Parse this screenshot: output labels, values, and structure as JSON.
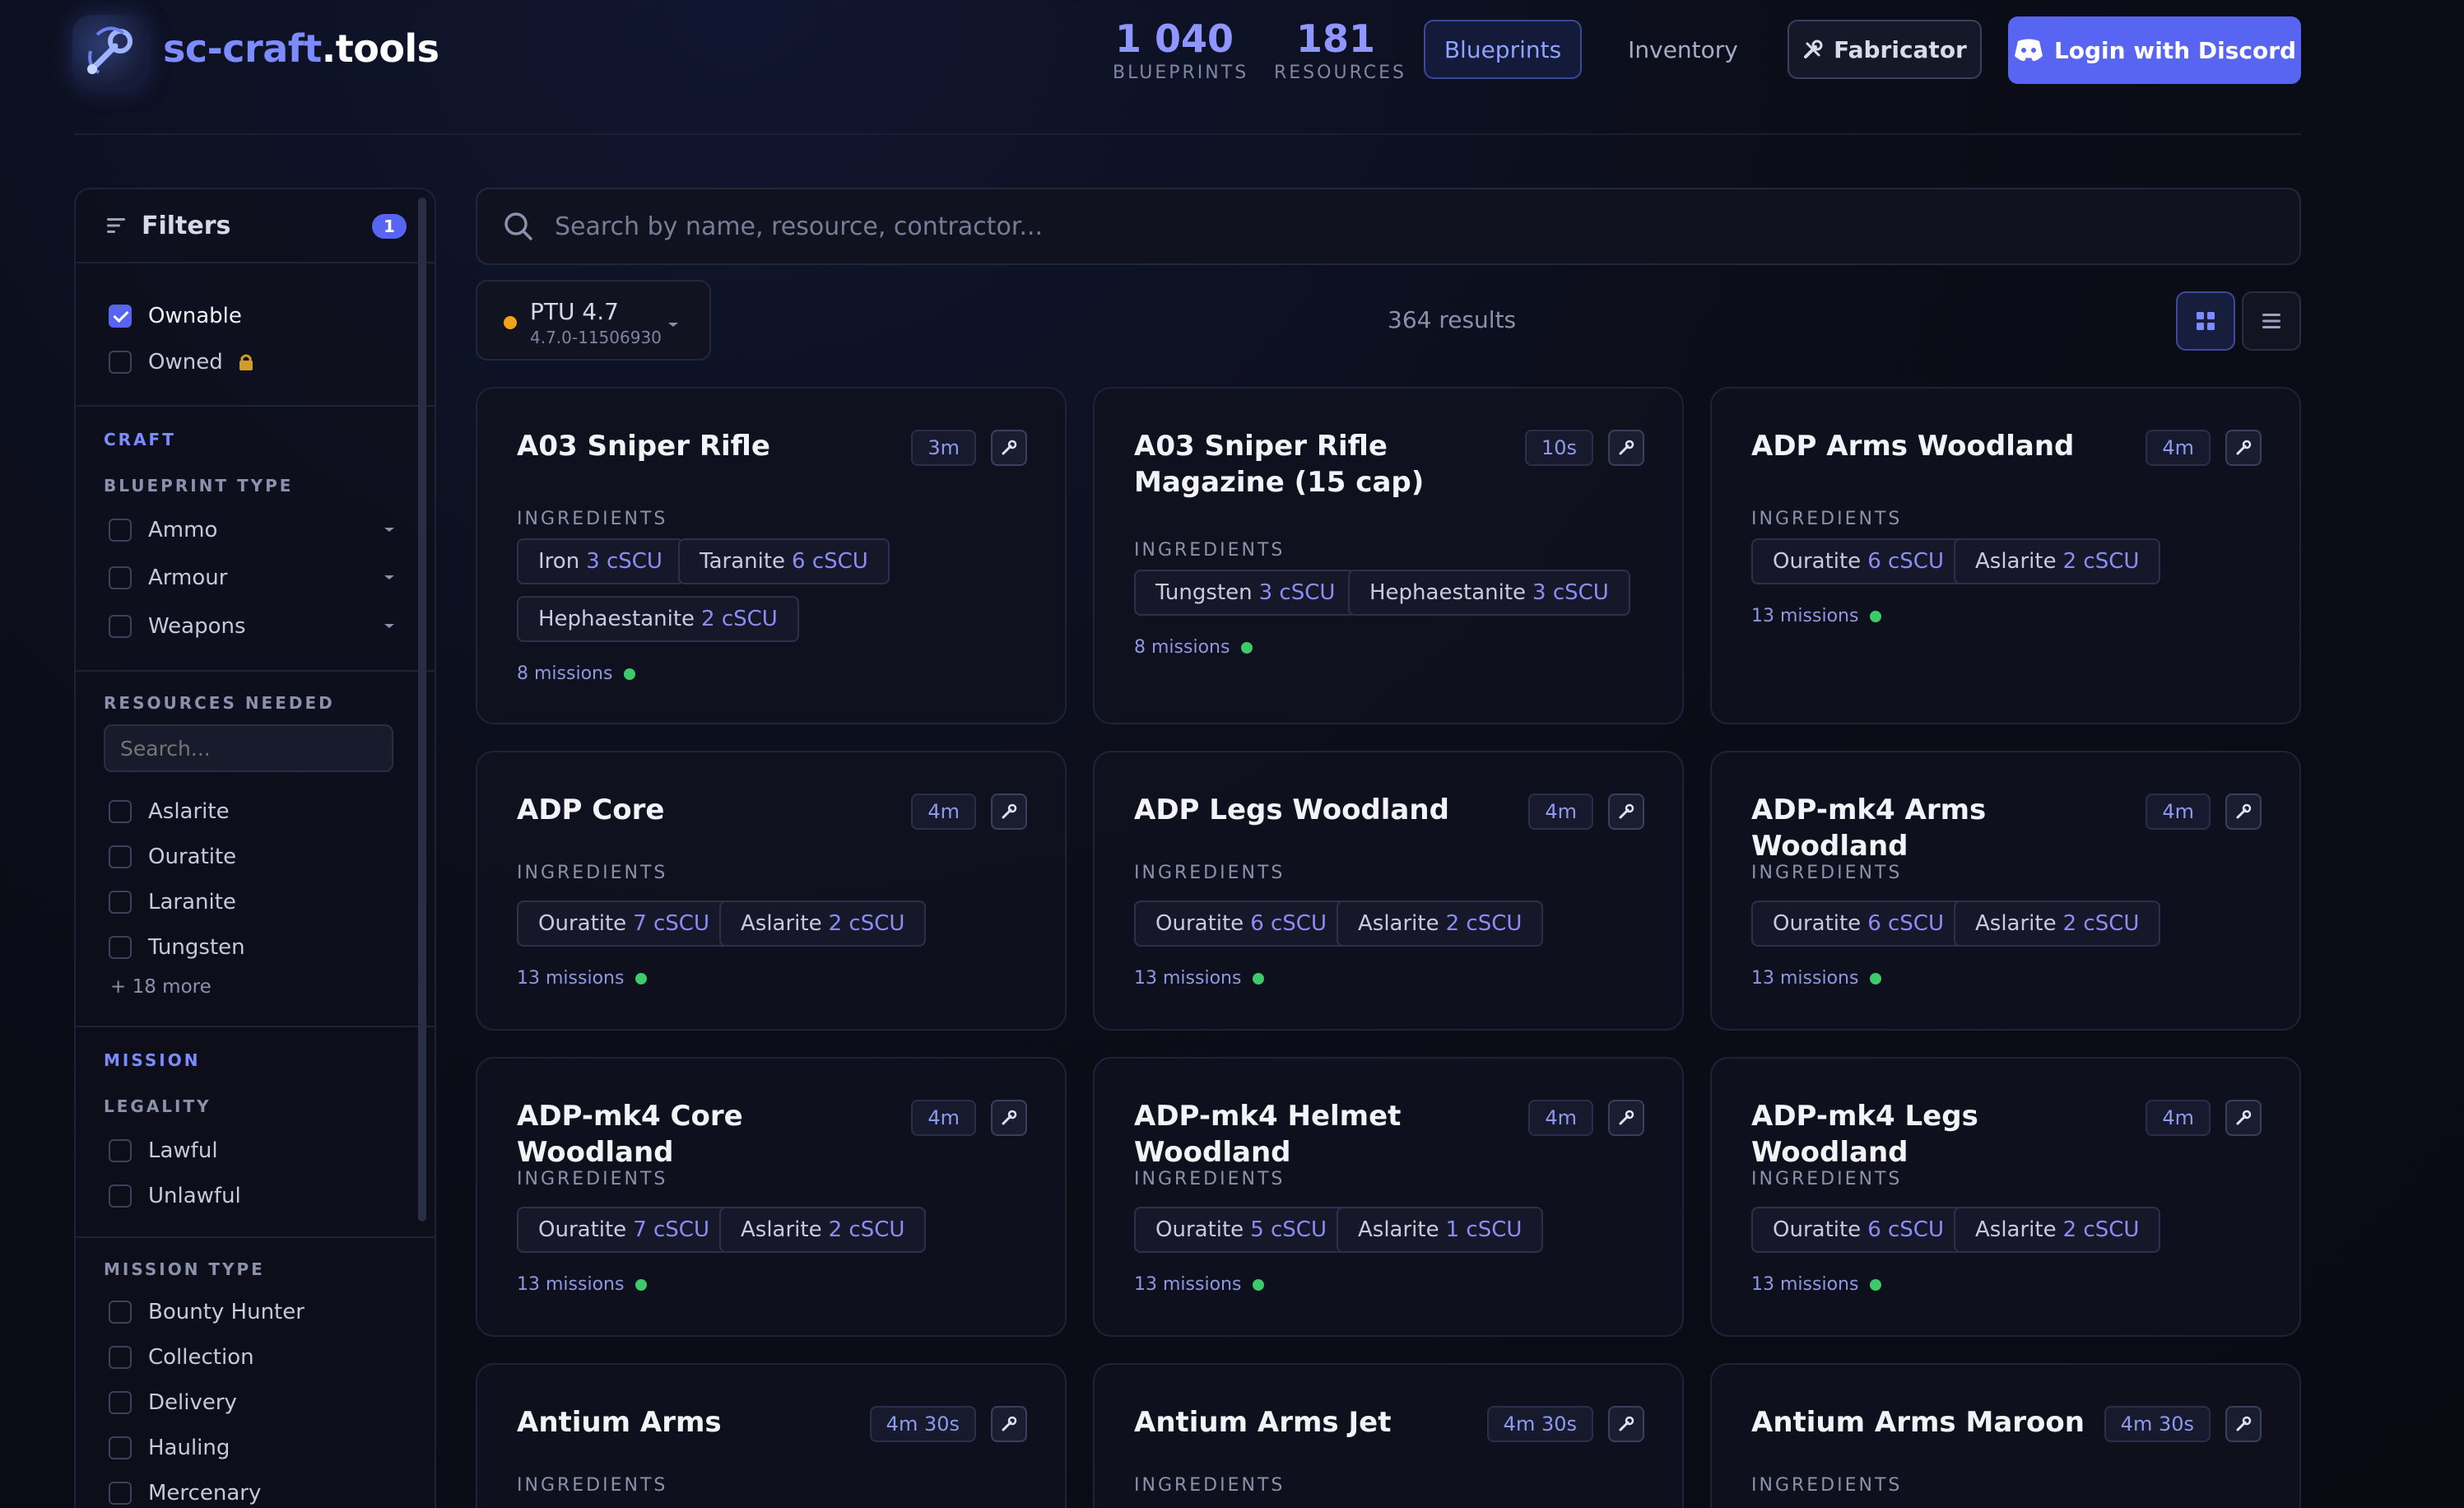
{
  "brand": {
    "prefix": "sc-craft",
    "suffix": ".tools"
  },
  "stats": [
    {
      "value": "1 040",
      "label": "BLUEPRINTS"
    },
    {
      "value": "181",
      "label": "RESOURCES"
    }
  ],
  "nav": {
    "blueprints": "Blueprints",
    "inventory": "Inventory",
    "fabricator": "Fabricator",
    "login": "Login with Discord"
  },
  "filters": {
    "title": "Filters",
    "badge": "1",
    "ownable": "Ownable",
    "owned": "Owned",
    "craft_title": "CRAFT",
    "blueprint_type_title": "BLUEPRINT TYPE",
    "blueprint_types": [
      "Ammo",
      "Armour",
      "Weapons"
    ],
    "resources_title": "RESOURCES NEEDED",
    "resource_search_placeholder": "Search...",
    "resources": [
      "Aslarite",
      "Ouratite",
      "Laranite",
      "Tungsten"
    ],
    "more": "+ 18 more",
    "mission_title": "MISSION",
    "legality_title": "LEGALITY",
    "legality": [
      "Lawful",
      "Unlawful"
    ],
    "mission_type_title": "MISSION TYPE",
    "mission_types": [
      "Bounty Hunter",
      "Collection",
      "Delivery",
      "Hauling",
      "Mercenary"
    ]
  },
  "search": {
    "placeholder": "Search by name, resource, contractor..."
  },
  "version": {
    "name": "PTU 4.7",
    "build": "4.7.0-11506930",
    "status_color": "#f0a21e"
  },
  "results": "364 results",
  "ingredients_label": "INGREDIENTS",
  "cards": [
    {
      "title": "A03 Sniper Rifle",
      "time": "3m",
      "ingredients": [
        [
          "Iron",
          "3 cSCU"
        ],
        [
          "Taranite",
          "6 cSCU"
        ],
        [
          "Hephaestanite",
          "2 cSCU"
        ]
      ],
      "missions": "8 missions"
    },
    {
      "title": "A03 Sniper Rifle Magazine (15 cap)",
      "time": "10s",
      "ingredients": [
        [
          "Tungsten",
          "3 cSCU"
        ],
        [
          "Hephaestanite",
          "3 cSCU"
        ]
      ],
      "missions": "8 missions"
    },
    {
      "title": "ADP Arms Woodland",
      "time": "4m",
      "ingredients": [
        [
          "Ouratite",
          "6 cSCU"
        ],
        [
          "Aslarite",
          "2 cSCU"
        ]
      ],
      "missions": "13 missions"
    },
    {
      "title": "ADP Core",
      "time": "4m",
      "ingredients": [
        [
          "Ouratite",
          "7 cSCU"
        ],
        [
          "Aslarite",
          "2 cSCU"
        ]
      ],
      "missions": "13 missions"
    },
    {
      "title": "ADP Legs Woodland",
      "time": "4m",
      "ingredients": [
        [
          "Ouratite",
          "6 cSCU"
        ],
        [
          "Aslarite",
          "2 cSCU"
        ]
      ],
      "missions": "13 missions"
    },
    {
      "title": "ADP-mk4 Arms Woodland",
      "time": "4m",
      "ingredients": [
        [
          "Ouratite",
          "6 cSCU"
        ],
        [
          "Aslarite",
          "2 cSCU"
        ]
      ],
      "missions": "13 missions"
    },
    {
      "title": "ADP-mk4 Core Woodland",
      "time": "4m",
      "ingredients": [
        [
          "Ouratite",
          "7 cSCU"
        ],
        [
          "Aslarite",
          "2 cSCU"
        ]
      ],
      "missions": "13 missions"
    },
    {
      "title": "ADP-mk4 Helmet Woodland",
      "time": "4m",
      "ingredients": [
        [
          "Ouratite",
          "5 cSCU"
        ],
        [
          "Aslarite",
          "1 cSCU"
        ]
      ],
      "missions": "13 missions"
    },
    {
      "title": "ADP-mk4 Legs Woodland",
      "time": "4m",
      "ingredients": [
        [
          "Ouratite",
          "6 cSCU"
        ],
        [
          "Aslarite",
          "2 cSCU"
        ]
      ],
      "missions": "13 missions"
    },
    {
      "title": "Antium Arms",
      "time": "4m 30s",
      "ingredients": [],
      "missions": ""
    },
    {
      "title": "Antium Arms Jet",
      "time": "4m 30s",
      "ingredients": [],
      "missions": ""
    },
    {
      "title": "Antium Arms Maroon",
      "time": "4m 30s",
      "ingredients": [],
      "missions": ""
    }
  ],
  "icons": {
    "logo": "wrench-logo-icon",
    "filter": "filter-lines-icon",
    "search": "search-icon",
    "discord": "discord-icon",
    "fabricator": "tools-icon",
    "grid": "grid-icon",
    "list": "list-icon",
    "craft": "wrench-icon",
    "lock": "lock-icon"
  },
  "colors": {
    "accent": "#5865f2",
    "stat": "#8f96ff",
    "ok": "#3ec96b"
  }
}
